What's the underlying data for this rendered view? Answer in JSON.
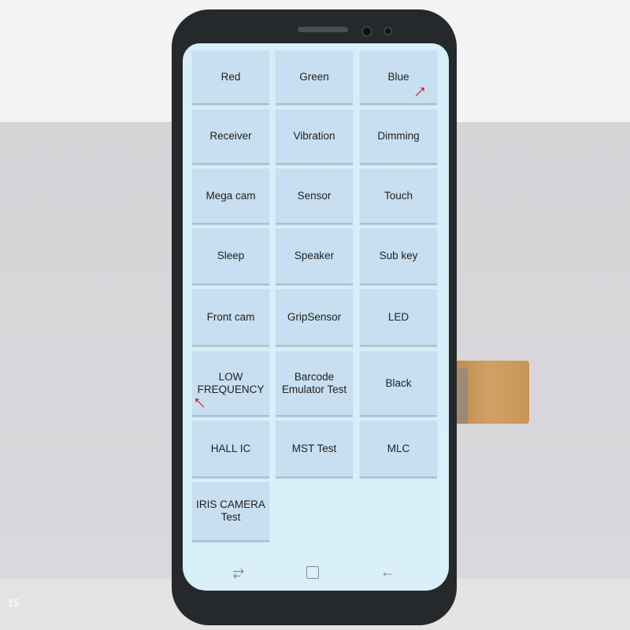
{
  "buttons": [
    [
      "Red",
      "Green",
      "Blue"
    ],
    [
      "Receiver",
      "Vibration",
      "Dimming"
    ],
    [
      "Mega cam",
      "Sensor",
      "Touch"
    ],
    [
      "Sleep",
      "Speaker",
      "Sub key"
    ],
    [
      "Front cam",
      "GripSensor",
      "LED"
    ],
    [
      "LOW FREQUENCY",
      "Barcode Emulator Test",
      "Black"
    ],
    [
      "HALL IC",
      "MST Test",
      "MLC"
    ],
    [
      "IRIS CAMERA Test"
    ]
  ],
  "nav": {
    "recents": "recents-icon",
    "home": "home-icon",
    "back": "back-icon"
  },
  "watermark": "15",
  "colors": {
    "button": "#c7dff0",
    "screen": "#d7eef8",
    "arrow": "#e01010"
  }
}
